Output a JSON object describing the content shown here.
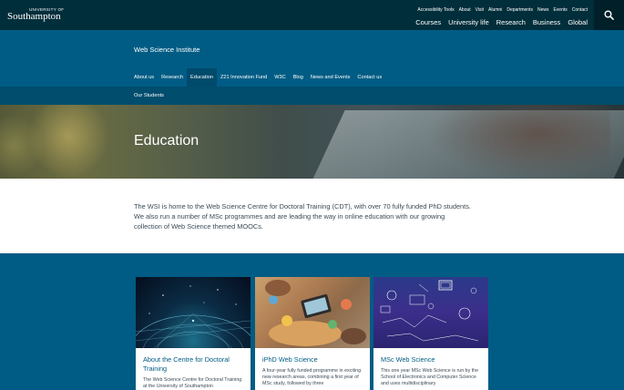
{
  "brand": {
    "university_top": "University of",
    "university_name": "Southampton"
  },
  "utility_links": [
    "Accessibility Tools",
    "About",
    "Visit",
    "Alumni",
    "Departments",
    "News",
    "Events",
    "Contact"
  ],
  "main_nav": [
    "Courses",
    "University life",
    "Research",
    "Business",
    "Global"
  ],
  "institute": {
    "title": "Web Science Institute"
  },
  "site_nav": [
    {
      "label": "About us"
    },
    {
      "label": "Research"
    },
    {
      "label": "Education",
      "active": true
    },
    {
      "label": "Z21 Innovation Fund"
    },
    {
      "label": "W3C"
    },
    {
      "label": "Blog"
    },
    {
      "label": "News and Events"
    },
    {
      "label": "Contact us"
    }
  ],
  "sub_nav": {
    "item": "Our Students"
  },
  "hero": {
    "title": "Education"
  },
  "intro": {
    "text": "The WSI is home to the Web Science Centre for Doctoral Training (CDT), with over 70 fully funded PhD students. We also run a number of MSc programmes and are leading the way in online education with our growing collection of Web Science themed MOOCs."
  },
  "cards": [
    {
      "title": "About the Centre for Doctoral Training",
      "desc": "The Web Science Centre for Doctoral Training at the University of Southampton"
    },
    {
      "title": "iPhD Web Science",
      "desc": "A four-year fully funded programme in exciting new research areas, combining a first year of MSc study, followed by three"
    },
    {
      "title": "MSc Web Science",
      "desc": "This one year MSc Web Science is run by the School of Electronics and Computer Science and uses multidisciplinary"
    }
  ],
  "colors": {
    "topbar": "#002e3b",
    "primary": "#005c84",
    "active_tab": "#004a6b"
  }
}
